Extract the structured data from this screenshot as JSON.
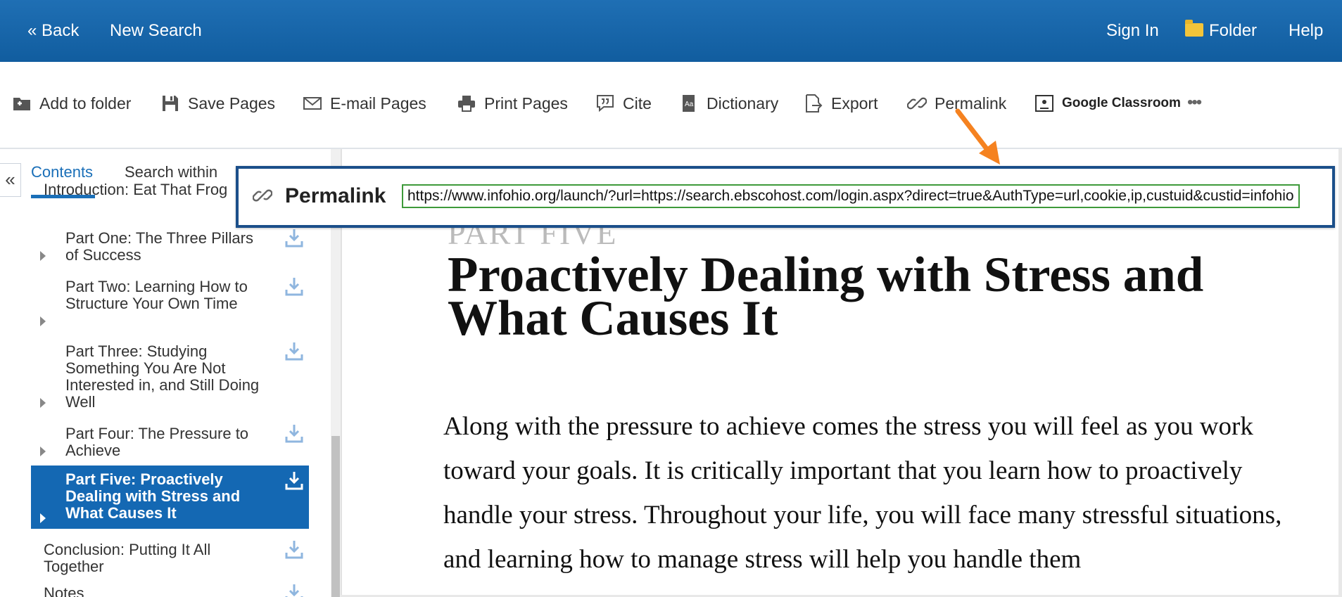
{
  "topbar": {
    "back_label": "« Back",
    "new_search_label": "New Search",
    "sign_in_label": "Sign In",
    "folder_label": "Folder",
    "help_label": "Help"
  },
  "toolbar": {
    "add_to_folder": "Add to folder",
    "save_pages": "Save Pages",
    "email_pages": "E-mail Pages",
    "print_pages": "Print Pages",
    "cite": "Cite",
    "dictionary": "Dictionary",
    "export": "Export",
    "permalink": "Permalink",
    "google_classroom": "Google Classroom",
    "more": "•••"
  },
  "sidebar": {
    "collapse_glyph": "«",
    "tabs": [
      "Contents",
      "Search within"
    ],
    "toc": [
      {
        "title": "Introduction: Eat That Frog",
        "level": 1,
        "expandable": false,
        "selected": false
      },
      {
        "title": "Part One: The Three Pillars of Success",
        "level": 2,
        "expandable": true,
        "selected": false
      },
      {
        "title": "Part Two: Learning How to Structure Your Own Time",
        "level": 2,
        "expandable": true,
        "selected": false
      },
      {
        "title": "Part Three: Studying Something You Are Not Interested in, and Still Doing Well",
        "level": 2,
        "expandable": true,
        "selected": false
      },
      {
        "title": "Part Four: The Pressure to Achieve",
        "level": 2,
        "expandable": true,
        "selected": false
      },
      {
        "title": "Part Five: Proactively Dealing with Stress and What Causes It",
        "level": 2,
        "expandable": true,
        "selected": true
      },
      {
        "title": "Conclusion: Putting It All Together",
        "level": 1,
        "expandable": false,
        "selected": false
      },
      {
        "title": "Notes",
        "level": 1,
        "expandable": false,
        "selected": false
      }
    ]
  },
  "document": {
    "part_label": "PART FIVE",
    "title": "Proactively Dealing with Stress and What Causes It",
    "body": "Along with the pressure to achieve comes the stress you will feel as you work toward your goals. It is critically important that you learn how to proactively handle your stress. Throughout your life, you will face many stressful situations, and learning how to manage stress will help you handle them"
  },
  "permalink_popup": {
    "label": "Permalink",
    "url": "https://www.infohio.org/launch/?url=https://search.ebscohost.com/login.aspx?direct=true&AuthType=url,cookie,ip,custuid&custid=infohio&db=nlebk"
  },
  "colors": {
    "header_blue": "#1565a8",
    "accent_blue": "#1a6fb8",
    "selected_bg": "#1468b3",
    "popup_border": "#1b4f8a",
    "input_border": "#3e9a3a",
    "annotation_arrow": "#f58220"
  },
  "icons": {
    "add_to_folder": "folder-plus-icon",
    "save_pages": "floppy-disk-icon",
    "email_pages": "envelope-icon",
    "print_pages": "printer-icon",
    "cite": "quote-bubble-icon",
    "dictionary": "dictionary-book-icon",
    "export": "export-document-icon",
    "permalink": "link-icon",
    "google_classroom": "google-classroom-icon",
    "toc_item": "download-icon"
  }
}
